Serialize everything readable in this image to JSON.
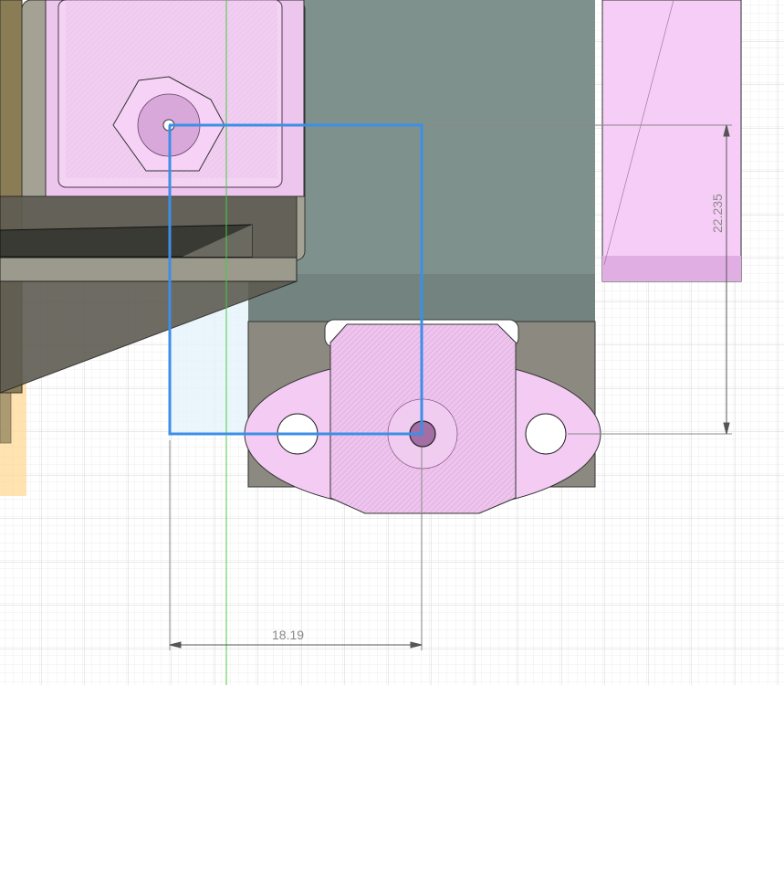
{
  "viewport": {
    "background": "#ffffff",
    "grid_color": "#e2e2e2",
    "grid_major_color": "#d0d0d0",
    "axis_color": "#44cc44"
  },
  "sketch": {
    "line_color": "#3c8fe6",
    "fill_color": "#e6f4fb"
  },
  "dimensions": {
    "horizontal": "18.19",
    "vertical": "22.235"
  },
  "colors": {
    "body_pink": "#f0c8f0",
    "body_dark": "#7f8e8a",
    "body_gray": "#8c8a80",
    "tan": "#8a7d55",
    "highlight_orange": "#ffd890"
  }
}
